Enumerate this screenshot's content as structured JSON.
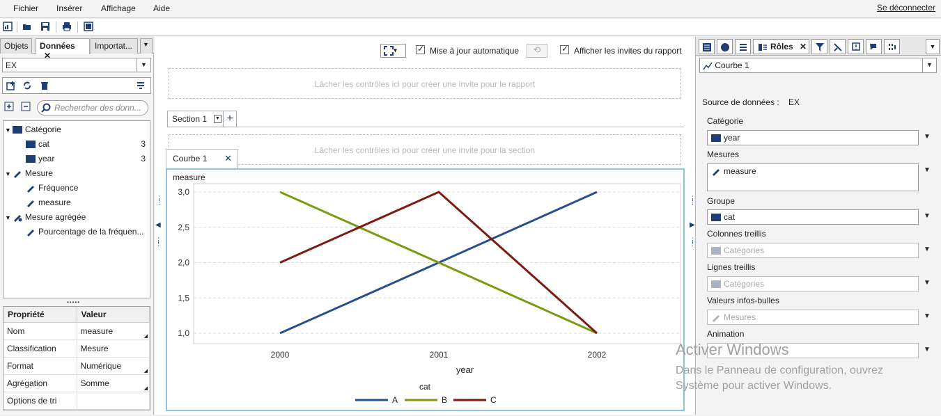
{
  "menubar": {
    "items": [
      "Fichier",
      "Insérer",
      "Affichage",
      "Aide"
    ],
    "logout": "Se déconnecter"
  },
  "toolbar": {
    "icons": [
      "new-report-icon",
      "open-icon",
      "save-icon",
      "print-icon",
      "view-icon"
    ]
  },
  "left": {
    "tabs": [
      "Objets",
      "Données",
      "Importat..."
    ],
    "active_tab": "Données",
    "datasource": "EX",
    "search_placeholder": "Rechercher des donn...",
    "tree": [
      {
        "type": "group",
        "label": "Catégorie",
        "icon": "category-icon"
      },
      {
        "type": "item",
        "label": "cat",
        "count": "3",
        "icon": "category-icon"
      },
      {
        "type": "item",
        "label": "year",
        "count": "3",
        "icon": "category-icon"
      },
      {
        "type": "group",
        "label": "Mesure",
        "icon": "measure-icon"
      },
      {
        "type": "item",
        "label": "Fréquence",
        "icon": "measure-icon"
      },
      {
        "type": "item",
        "label": "measure",
        "icon": "measure-icon"
      },
      {
        "type": "group",
        "label": "Mesure agrégée",
        "icon": "aggregated-measure-icon"
      },
      {
        "type": "item",
        "label": "Pourcentage de la fréquen...",
        "icon": "measure-icon"
      }
    ],
    "props": {
      "headers": [
        "Propriété",
        "Valeur"
      ],
      "rows": [
        [
          "Nom",
          "measure"
        ],
        [
          "Classification",
          "Mesure"
        ],
        [
          "Format",
          "Numérique"
        ],
        [
          "Agrégation",
          "Somme"
        ],
        [
          "Options de tri",
          ""
        ]
      ]
    }
  },
  "center": {
    "auto_update": "Mise à jour automatique",
    "show_prompts": "Afficher les invites du rapport",
    "report_drop": "Lâcher les contrôles ici pour créer une invite pour le rapport",
    "section_tab": "Section 1",
    "section_drop": "Lâcher les contrôles ici pour créer une invite pour la section",
    "object_tab": "Courbe 1"
  },
  "chart_data": {
    "type": "line",
    "xlabel": "year",
    "ylabel": "measure",
    "categories": [
      "2000",
      "2001",
      "2002"
    ],
    "ylim": [
      1.0,
      3.0
    ],
    "yticks": [
      "1,0",
      "1,5",
      "2,0",
      "2,5",
      "3,0"
    ],
    "legend_title": "cat",
    "series": [
      {
        "name": "A",
        "values": [
          1,
          2,
          3
        ],
        "color": "#274f8f"
      },
      {
        "name": "B",
        "values": [
          3,
          2,
          1
        ],
        "color": "#7a9a12"
      },
      {
        "name": "C",
        "values": [
          2,
          3,
          1
        ],
        "color": "#7d1a12"
      }
    ]
  },
  "right": {
    "object_select": "Courbe 1",
    "roles_tab": "Rôles",
    "source_label": "Source de données :",
    "source_value": "EX",
    "roles": [
      {
        "label": "Catégorie",
        "value": "year",
        "disabled": false,
        "kind": "cat"
      },
      {
        "label": "Mesures",
        "value": "measure",
        "disabled": false,
        "kind": "meas"
      },
      {
        "label": "Groupe",
        "value": "cat",
        "disabled": false,
        "kind": "cat"
      },
      {
        "label": "Colonnes treillis",
        "value": "Catégories",
        "disabled": true,
        "kind": "cat"
      },
      {
        "label": "Lignes treillis",
        "value": "Catégories",
        "disabled": true,
        "kind": "cat"
      },
      {
        "label": "Valeurs infos-bulles",
        "value": "Mesures",
        "disabled": true,
        "kind": "meas"
      },
      {
        "label": "Animation",
        "value": "",
        "disabled": true,
        "kind": "none"
      }
    ]
  },
  "watermark": {
    "line1": "Activer Windows",
    "line2": "Dans le Panneau de configuration, ouvrez",
    "line3": "Système pour activer Windows."
  }
}
